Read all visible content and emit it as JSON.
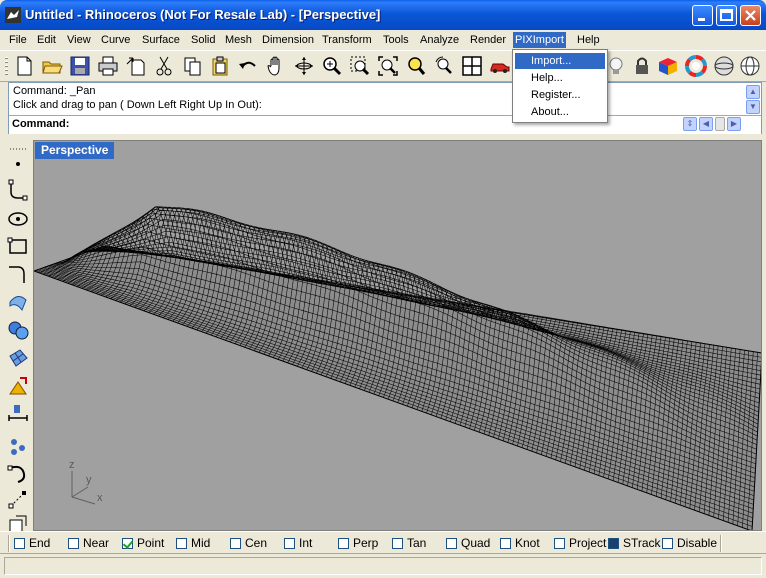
{
  "window": {
    "title": "Untitled - Rhinoceros (Not For Resale Lab) - [Perspective]"
  },
  "menu": {
    "items": [
      "File",
      "Edit",
      "View",
      "Curve",
      "Surface",
      "Solid",
      "Mesh",
      "Dimension",
      "Transform",
      "Tools",
      "Analyze",
      "Render",
      "PIXImport",
      "Help"
    ],
    "active": "PIXImport"
  },
  "dropdown": {
    "items": [
      "Import...",
      "Help...",
      "Register...",
      "About..."
    ],
    "highlighted": "Import..."
  },
  "command": {
    "history": [
      "Command: _Pan",
      "Click and drag to pan ( Down  Left  Right  Up  In  Out):"
    ],
    "prompt_label": "Command:",
    "value": ""
  },
  "viewport": {
    "title": "Perspective",
    "axes": [
      "z",
      "y",
      "x"
    ]
  },
  "osnap": [
    {
      "label": "End",
      "checked": false
    },
    {
      "label": "Near",
      "checked": false
    },
    {
      "label": "Point",
      "checked": true
    },
    {
      "label": "Mid",
      "checked": false
    },
    {
      "label": "Cen",
      "checked": false
    },
    {
      "label": "Int",
      "checked": false
    },
    {
      "label": "Perp",
      "checked": false
    },
    {
      "label": "Tan",
      "checked": false
    },
    {
      "label": "Quad",
      "checked": false
    },
    {
      "label": "Knot",
      "checked": false
    },
    {
      "label": "Project",
      "checked": false
    },
    {
      "label": "STrack",
      "checked": true
    },
    {
      "label": "Disable",
      "checked": false
    }
  ],
  "toolbar_icons": [
    "new-icon",
    "open-icon",
    "save-icon",
    "print-icon",
    "import-icon",
    "cut-icon",
    "copy-icon",
    "paste-icon",
    "undo-icon",
    "pan-hand-icon",
    "rotate-icon",
    "zoom-icon",
    "zoom-window-icon",
    "zoom-extents-icon",
    "zoom-selected-icon",
    "rotate-view-icon",
    "four-viewports-icon",
    "render-car-icon"
  ],
  "toolbar_right_icons": [
    "light-bulb-icon",
    "lock-icon",
    "material-icon",
    "color-wheel-icon",
    "sphere-icon",
    "sphere-wire-icon"
  ],
  "left_icons": [
    "point-icon",
    "curve-icon",
    "circle-icon",
    "rectangle-icon",
    "fillet-curve-icon",
    "surface-icon",
    "solid-sphere-icon",
    "mesh-icon",
    "transform-icon",
    "dimension-icon",
    "group-icon",
    "curve-tools-icon",
    "snap-icon",
    "block-icon"
  ],
  "colors": {
    "title_blue": "#0a57d8",
    "menu_highlight": "#316ac5",
    "viewport_bg": "#a0a0a0",
    "face": "#ece9d8"
  }
}
